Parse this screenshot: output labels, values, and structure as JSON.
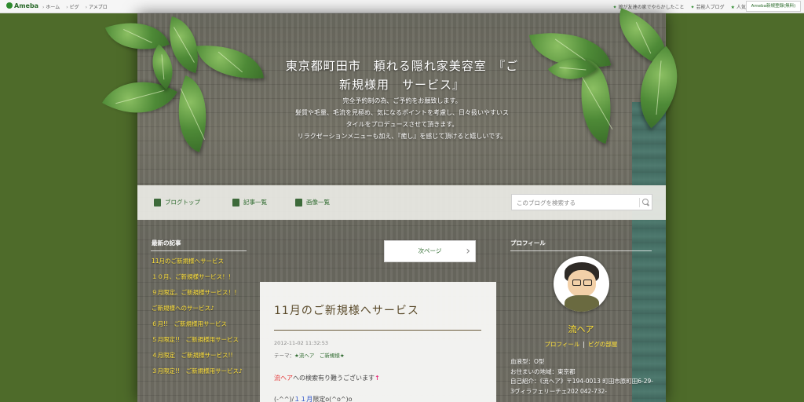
{
  "topbar": {
    "logo": "Ameba",
    "nav": [
      "ホーム",
      "ピグ",
      "アメブロ"
    ],
    "right_links": [
      "娘が友達の家でやらかしたこと",
      "芸能人ブログ",
      "人気ブログ"
    ],
    "register": "Ameba新規登録(無料)"
  },
  "header": {
    "title_line1": "東京都町田市　頼れる隠れ家美容室　『ご",
    "title_line2": "新規様用　サービス』",
    "desc": [
      "完全予約制の為、ご予約をお願致します。",
      "髪質や毛量、毛流を見極め、気になるポイントを考慮し、日々扱いやすいス",
      "タイルをプロデュースさせて頂きます。",
      "リラクゼーションメニューも加え、『癒し』を感じて頂けると嬉しいです。"
    ]
  },
  "nav": {
    "items": [
      "ブログトップ",
      "記事一覧",
      "画像一覧"
    ],
    "search_placeholder": "このブログを検索する"
  },
  "sidebar": {
    "heading": "最新の記事",
    "items": [
      "11月のご新規様へサービス",
      "１０月、ご新規様サービス！！",
      "９月限定。ご新規様サービス！！",
      "ご新規様へのサービス♪",
      "６月!!　ご新規様用サービス",
      "５月限定!!　ご新規様用サービス",
      "４月限定　ご新規様サービス!!",
      "３月限定!!　ご新規様用サービス♪"
    ]
  },
  "next_page": "次ページ",
  "article": {
    "title": "11月のご新規様へサービス",
    "date": "2012-11-02 11:32:53",
    "theme_label": "テーマ：",
    "theme_1": "★流ヘア",
    "theme_2": "ご新規様★",
    "body_red": "流ヘア",
    "body_rest": "への検索有り難うございます",
    "body_arrow": "↑",
    "body2_prefix": "(-^^)/",
    "body2_blue": "１１月",
    "body2_rest": "限定о(^о^)о"
  },
  "profile": {
    "heading": "プロフィール",
    "name": "流ヘア",
    "link_profile": "プロフィール",
    "link_sep": "|",
    "link_pig": "ピグの部屋",
    "blood": "血液型：O型",
    "area": "お住まいの地域：東京都",
    "intro": "自己紹介：《流ヘア》〒194-0013 町田市原町田6-29-3ヴィラフェリーチェ202 042-732-"
  }
}
